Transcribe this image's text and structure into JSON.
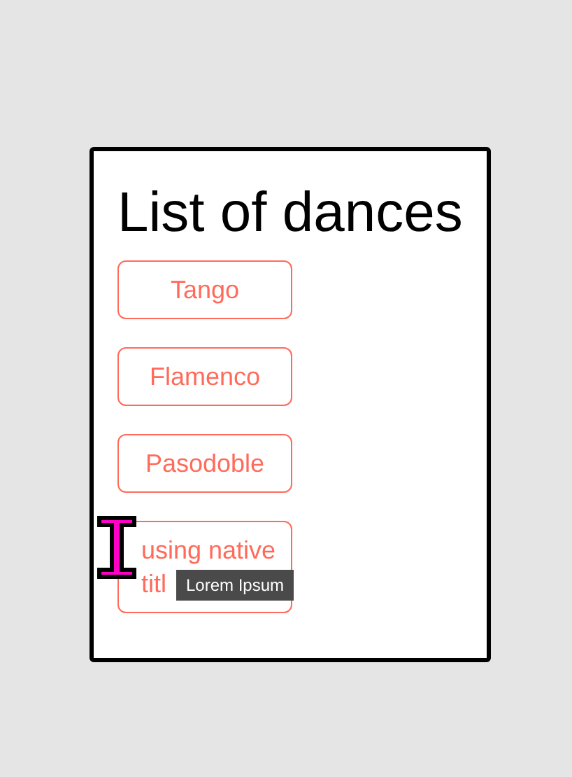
{
  "title": "List of dances",
  "dances": [
    {
      "label": "Tango"
    },
    {
      "label": "Flamenco"
    },
    {
      "label": "Pasodoble"
    },
    {
      "label": "using native titl"
    }
  ],
  "tooltip": {
    "text": "Lorem Ipsum"
  }
}
